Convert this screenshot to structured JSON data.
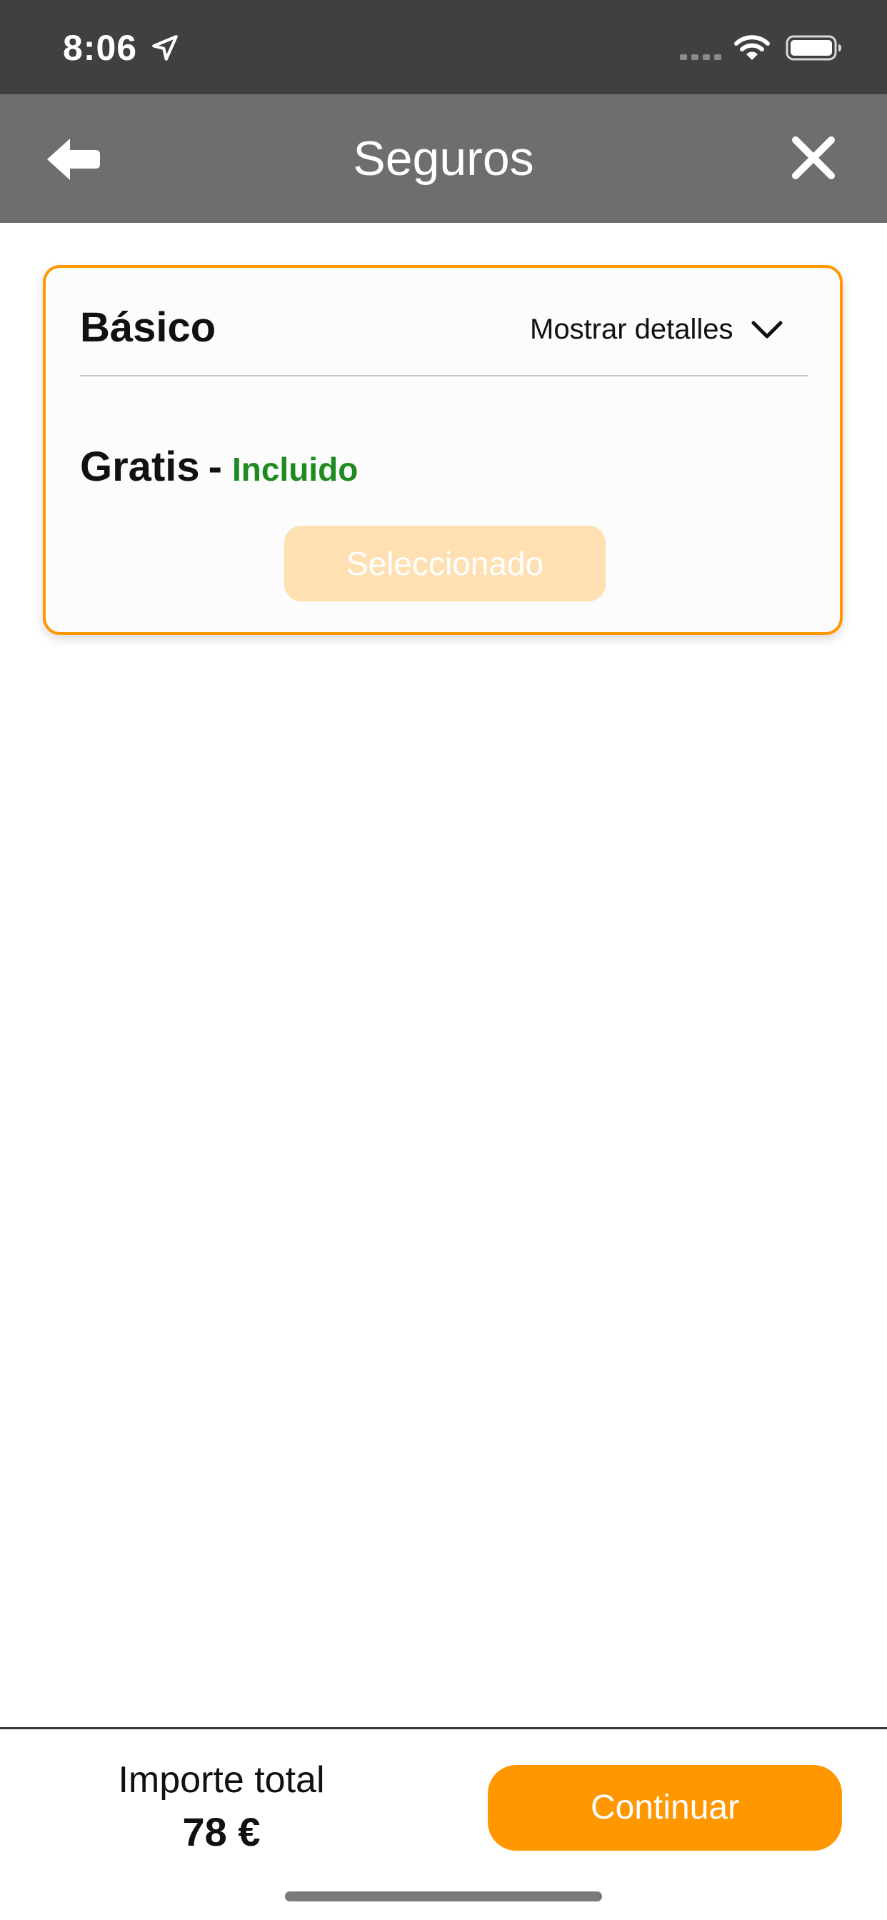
{
  "status_bar": {
    "time": "8:06",
    "icons": [
      "location-arrow-icon",
      "cellular-signal-icon",
      "wifi-icon",
      "battery-icon"
    ]
  },
  "nav": {
    "title": "Seguros",
    "back_icon": "back-arrow-icon",
    "close_icon": "close-icon"
  },
  "card": {
    "title": "Básico",
    "details_label": "Mostrar detalles",
    "details_icon": "chevron-down-icon",
    "price": "Gratis",
    "separator": "-",
    "included": "Incluido",
    "selected_label": "Seleccionado"
  },
  "footer": {
    "total_label": "Importe total",
    "total_value": "78 €",
    "continue_label": "Continuar"
  },
  "colors": {
    "accent": "#ff9800",
    "accent_light": "#ffe0b2",
    "included_green": "#1f8a1f",
    "status_bar": "#404040",
    "nav_bar": "#6e6e6e"
  }
}
